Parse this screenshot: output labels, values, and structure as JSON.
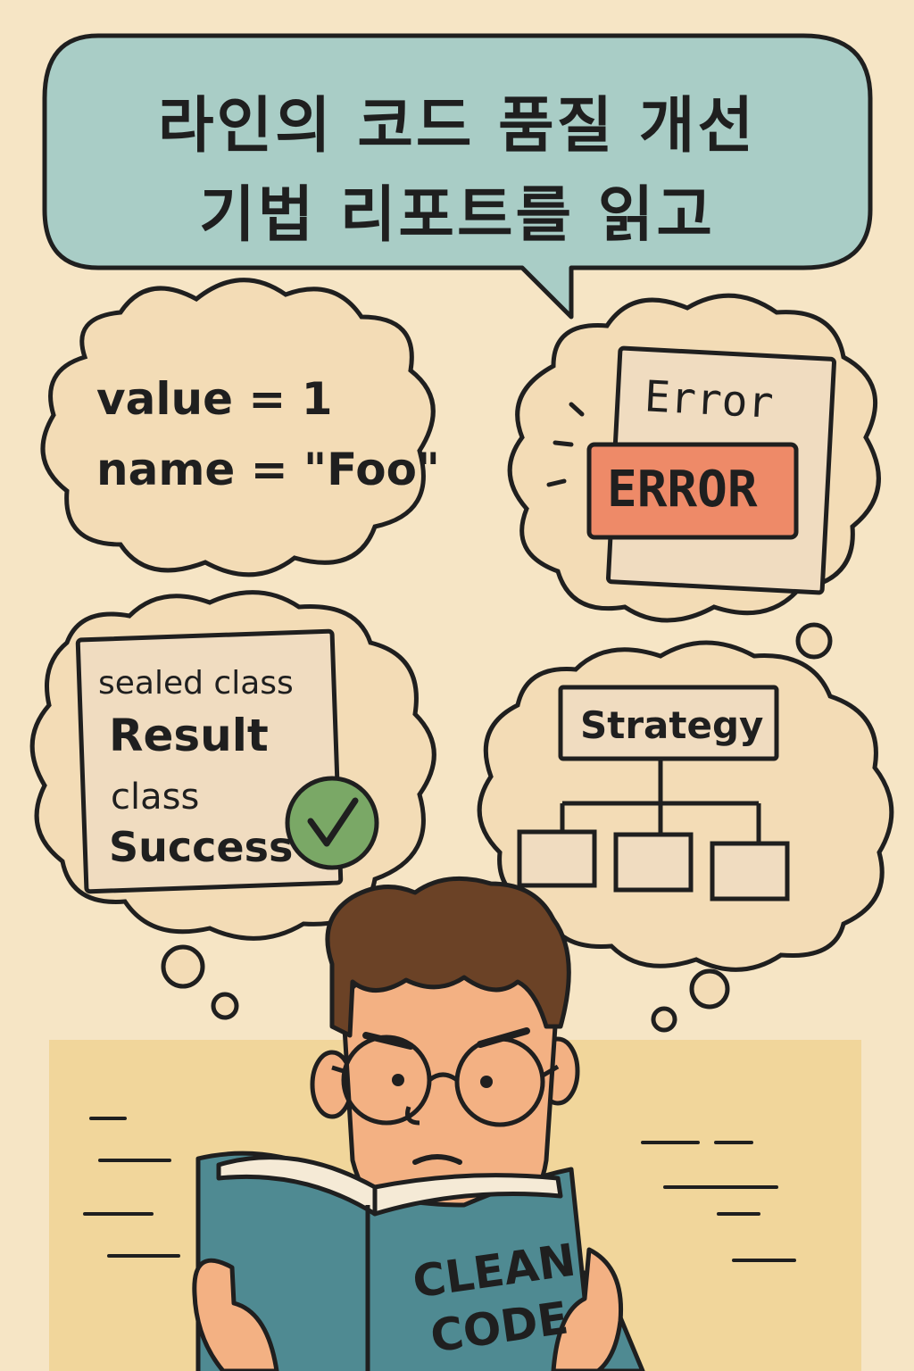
{
  "title": {
    "line1": "라인의 코드 품질 개선",
    "line2": "기법 리포트를 읽고"
  },
  "bubble_code": {
    "line1": "value = 1",
    "line2": "name = \"Foo\""
  },
  "bubble_error": {
    "small": "Error",
    "big": "ERROR"
  },
  "bubble_sealed": {
    "line1": "sealed class",
    "line2": "Result",
    "line3": "class",
    "line4": "Success"
  },
  "bubble_strategy": {
    "label": "Strategy"
  },
  "book": {
    "line1": "CLEAN",
    "line2": "CODE"
  },
  "colors": {
    "background": "#f6e5c5",
    "speech_bubble": "#a9cdc6",
    "thought_bubble": "#f3dcb6",
    "error_badge": "#ee8a68",
    "check_green": "#7aa866",
    "book_cover": "#4f8a92",
    "hair": "#6b4226",
    "skin": "#f3b183"
  },
  "icons": [
    "checkmark-icon",
    "tree-diagram-icon",
    "motion-lines-icon"
  ]
}
